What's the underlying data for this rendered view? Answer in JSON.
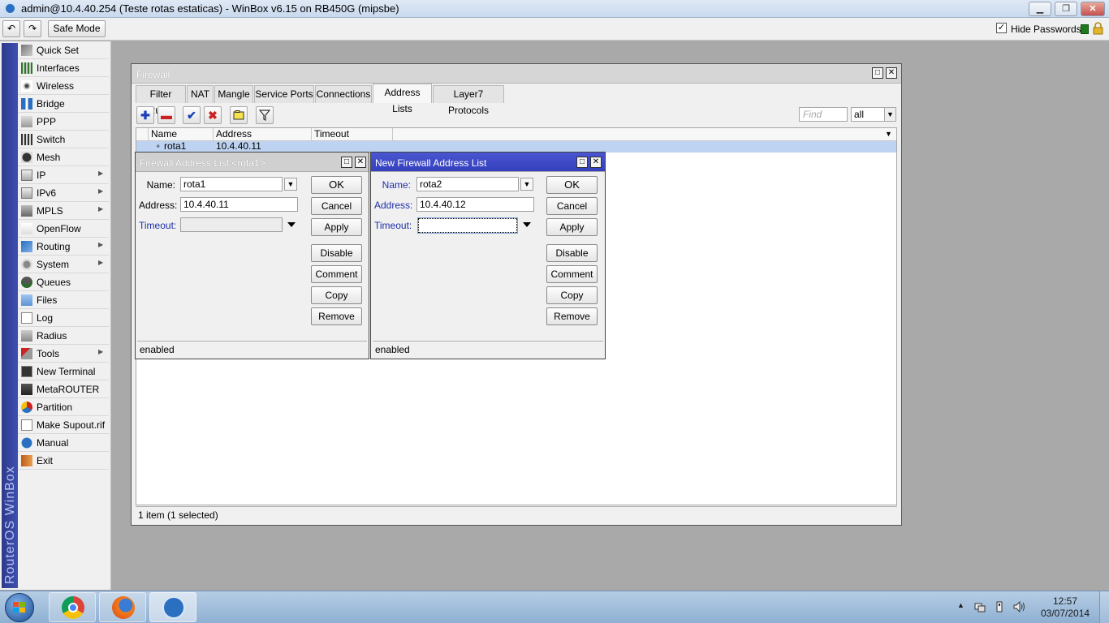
{
  "window": {
    "title": "admin@10.4.40.254 (Teste rotas estaticas) - WinBox v6.15 on RB450G (mipsbe)",
    "controls": [
      "minimize",
      "maximize",
      "close"
    ]
  },
  "toolbar": {
    "undo_icon": "undo-icon",
    "redo_icon": "redo-icon",
    "safe_mode": "Safe Mode",
    "hide_passwords_label": "Hide Passwords",
    "hide_passwords_checked": "✓"
  },
  "brand": "RouterOS WinBox",
  "menu": [
    {
      "label": "Quick Set",
      "icon": "quick-set-icon",
      "submenu": false
    },
    {
      "label": "Interfaces",
      "icon": "interfaces-icon",
      "submenu": false
    },
    {
      "label": "Wireless",
      "icon": "wireless-icon",
      "submenu": false
    },
    {
      "label": "Bridge",
      "icon": "bridge-icon",
      "submenu": false
    },
    {
      "label": "PPP",
      "icon": "ppp-icon",
      "submenu": false
    },
    {
      "label": "Switch",
      "icon": "switch-icon",
      "submenu": false
    },
    {
      "label": "Mesh",
      "icon": "mesh-icon",
      "submenu": false
    },
    {
      "label": "IP",
      "icon": "ip-icon",
      "submenu": true
    },
    {
      "label": "IPv6",
      "icon": "ipv6-icon",
      "submenu": true
    },
    {
      "label": "MPLS",
      "icon": "mpls-icon",
      "submenu": true
    },
    {
      "label": "OpenFlow",
      "icon": "openflow-icon",
      "submenu": false
    },
    {
      "label": "Routing",
      "icon": "routing-icon",
      "submenu": true
    },
    {
      "label": "System",
      "icon": "system-icon",
      "submenu": true
    },
    {
      "label": "Queues",
      "icon": "queues-icon",
      "submenu": false
    },
    {
      "label": "Files",
      "icon": "files-icon",
      "submenu": false
    },
    {
      "label": "Log",
      "icon": "log-icon",
      "submenu": false
    },
    {
      "label": "Radius",
      "icon": "radius-icon",
      "submenu": false
    },
    {
      "label": "Tools",
      "icon": "tools-icon",
      "submenu": true
    },
    {
      "label": "New Terminal",
      "icon": "terminal-icon",
      "submenu": false
    },
    {
      "label": "MetaROUTER",
      "icon": "metarouter-icon",
      "submenu": false
    },
    {
      "label": "Partition",
      "icon": "partition-icon",
      "submenu": false
    },
    {
      "label": "Make Supout.rif",
      "icon": "supout-icon",
      "submenu": false
    },
    {
      "label": "Manual",
      "icon": "manual-icon",
      "submenu": false
    },
    {
      "label": "Exit",
      "icon": "exit-icon",
      "submenu": false
    }
  ],
  "firewall": {
    "title": "Firewall",
    "tabs": [
      "Filter Rules",
      "NAT",
      "Mangle",
      "Service Ports",
      "Connections",
      "Address Lists",
      "Layer7 Protocols"
    ],
    "active_tab": "Address Lists",
    "find_placeholder": "Find",
    "filter_value": "all",
    "columns": [
      "Name",
      "Address",
      "Timeout"
    ],
    "rows": [
      {
        "name": "rota1",
        "address": "10.4.40.11",
        "timeout": ""
      }
    ],
    "status": "1 item (1 selected)"
  },
  "dialog1": {
    "title": "Firewall Address List <rota1>",
    "name_label": "Name:",
    "name_value": "rota1",
    "address_label": "Address:",
    "address_value": "10.4.40.11",
    "timeout_label": "Timeout:",
    "timeout_value": "",
    "buttons": [
      "OK",
      "Cancel",
      "Apply",
      "Disable",
      "Comment",
      "Copy",
      "Remove"
    ],
    "status": "enabled"
  },
  "dialog2": {
    "title": "New Firewall Address List",
    "name_label": "Name:",
    "name_value": "rota2",
    "address_label": "Address:",
    "address_value": "10.4.40.12",
    "timeout_label": "Timeout:",
    "timeout_value": "",
    "buttons": [
      "OK",
      "Cancel",
      "Apply",
      "Disable",
      "Comment",
      "Copy",
      "Remove"
    ],
    "status": "enabled"
  },
  "taskbar": {
    "apps": [
      {
        "name": "chrome",
        "icon": "chrome-icon"
      },
      {
        "name": "firefox",
        "icon": "firefox-icon"
      },
      {
        "name": "winbox",
        "icon": "winbox-icon"
      }
    ],
    "time": "12:57",
    "date": "03/07/2014"
  },
  "colors": {
    "brand_bar": "#2d3a8c",
    "selected_row": "#bed3f1",
    "active_dialog_title": "#3944c5",
    "blue_label": "#1f2fa8"
  }
}
